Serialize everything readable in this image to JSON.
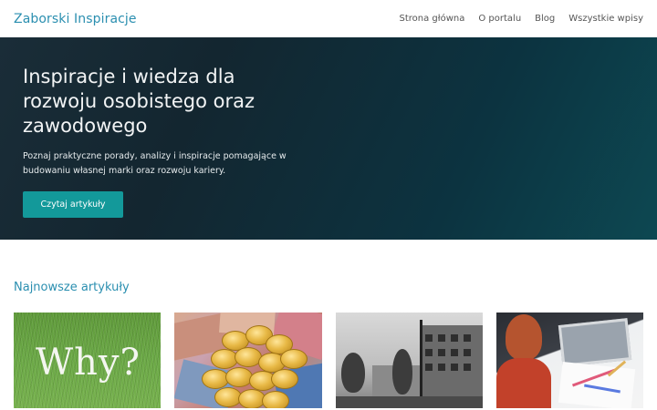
{
  "header": {
    "brand": "Zaborski Inspiracje",
    "nav": [
      "Strona główna",
      "O portalu",
      "Blog",
      "Wszystkie wpisy"
    ]
  },
  "hero": {
    "title": "Inspiracje i wiedza dla rozwoju osobistego oraz zawodowego",
    "subtitle": "Poznaj praktyczne porady, analizy i inspiracje pomagające w budowaniu własnej marki oraz rozwoju kariery.",
    "cta_label": "Czytaj artykuły"
  },
  "latest": {
    "title": "Najnowsze artykuły",
    "cards": [
      {
        "image": "grass-why-photo",
        "overlay_text": "Why?"
      },
      {
        "image": "coins-and-banknotes-photo"
      },
      {
        "image": "city-buildings-photo"
      },
      {
        "image": "desk-laptop-photo"
      }
    ]
  },
  "colors": {
    "brand": "#2b8fb0",
    "hero_bg": "#132630",
    "cta": "#13999a"
  }
}
